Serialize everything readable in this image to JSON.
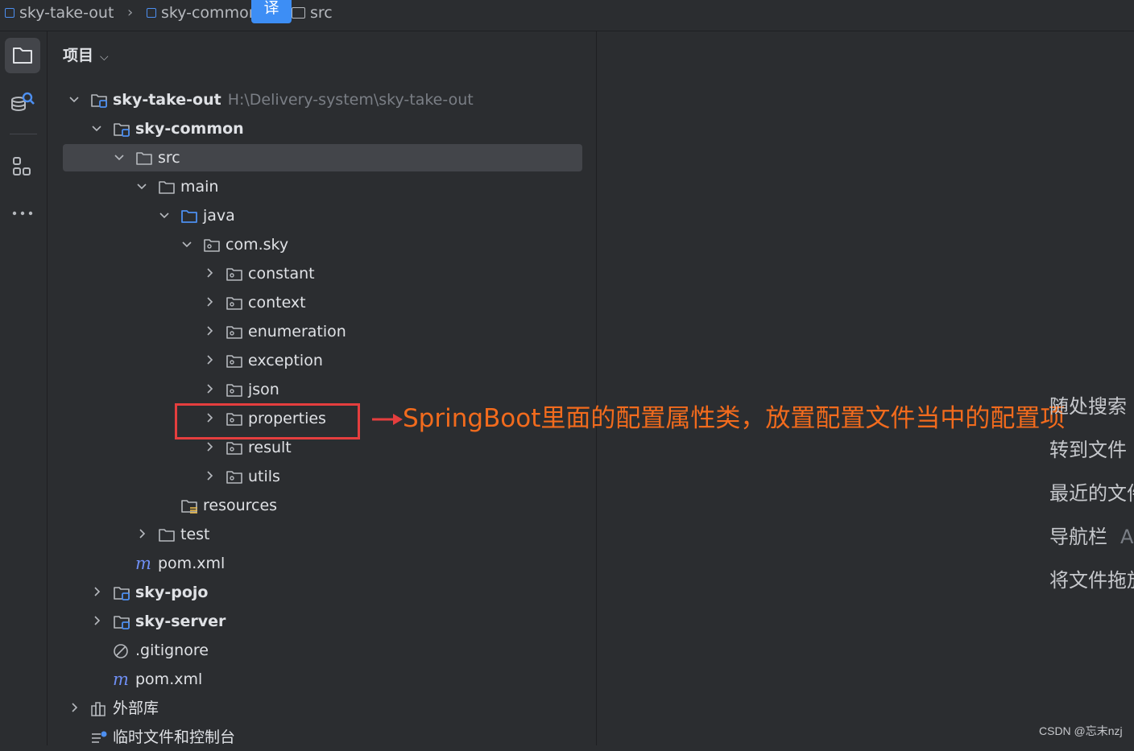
{
  "breadcrumb": {
    "items": [
      "sky-take-out",
      "sky-common",
      "src"
    ],
    "translate_label": "译"
  },
  "toolstrip": {
    "tools": [
      "project-tool",
      "database-tool",
      "structure-tool",
      "more-tool"
    ]
  },
  "panel": {
    "title": "项目",
    "tree": [
      {
        "label": "sky-take-out",
        "path": "H:\\Delivery-system\\sky-take-out",
        "depth": 0,
        "expanded": true,
        "icon": "module-folder-icon",
        "bold": true
      },
      {
        "label": "sky-common",
        "depth": 1,
        "expanded": true,
        "icon": "module-folder-icon",
        "bold": true
      },
      {
        "label": "src",
        "depth": 2,
        "expanded": true,
        "icon": "folder-icon",
        "selected": true
      },
      {
        "label": "main",
        "depth": 3,
        "expanded": true,
        "icon": "folder-icon"
      },
      {
        "label": "java",
        "depth": 4,
        "expanded": true,
        "icon": "source-folder-icon"
      },
      {
        "label": "com.sky",
        "depth": 5,
        "expanded": true,
        "icon": "package-icon"
      },
      {
        "label": "constant",
        "depth": 6,
        "expanded": false,
        "icon": "package-icon"
      },
      {
        "label": "context",
        "depth": 6,
        "expanded": false,
        "icon": "package-icon"
      },
      {
        "label": "enumeration",
        "depth": 6,
        "expanded": false,
        "icon": "package-icon"
      },
      {
        "label": "exception",
        "depth": 6,
        "expanded": false,
        "icon": "package-icon"
      },
      {
        "label": "json",
        "depth": 6,
        "expanded": false,
        "icon": "package-icon"
      },
      {
        "label": "properties",
        "depth": 6,
        "expanded": false,
        "icon": "package-icon"
      },
      {
        "label": "result",
        "depth": 6,
        "expanded": false,
        "icon": "package-icon"
      },
      {
        "label": "utils",
        "depth": 6,
        "expanded": false,
        "icon": "package-icon"
      },
      {
        "label": "resources",
        "depth": 4,
        "icon": "resources-folder-icon"
      },
      {
        "label": "test",
        "depth": 3,
        "expanded": false,
        "icon": "folder-icon"
      },
      {
        "label": "pom.xml",
        "depth": 2,
        "icon": "maven-icon"
      },
      {
        "label": "sky-pojo",
        "depth": 1,
        "expanded": false,
        "icon": "module-folder-icon",
        "bold": true
      },
      {
        "label": "sky-server",
        "depth": 1,
        "expanded": false,
        "icon": "module-folder-icon",
        "bold": true
      },
      {
        "label": ".gitignore",
        "depth": 1,
        "icon": "gitignore-icon"
      },
      {
        "label": "pom.xml",
        "depth": 1,
        "icon": "maven-icon"
      },
      {
        "label": "外部库",
        "depth": 0,
        "expanded": false,
        "icon": "library-icon"
      },
      {
        "label": "临时文件和控制台",
        "depth": 0,
        "icon": "scratches-icon"
      }
    ]
  },
  "annotation": {
    "text": "SpringBoot里面的配置属性类，放置配置文件当中的配置项",
    "color": "#f26b1d",
    "box_color": "#e53e3e"
  },
  "editor_hints": [
    {
      "label": "随处搜索",
      "key": ""
    },
    {
      "label": "转到文件",
      "key": ""
    },
    {
      "label": "最近的文件",
      "key": ""
    },
    {
      "label": "导航栏",
      "key": "A"
    },
    {
      "label": "将文件拖放",
      "key": ""
    }
  ],
  "watermark": "CSDN @忘末nzj",
  "colors": {
    "background": "#2b2d30",
    "selection": "#43454a",
    "accent_blue": "#3d8ef5",
    "text": "#dfe1e5",
    "muted": "#7a7e85"
  }
}
